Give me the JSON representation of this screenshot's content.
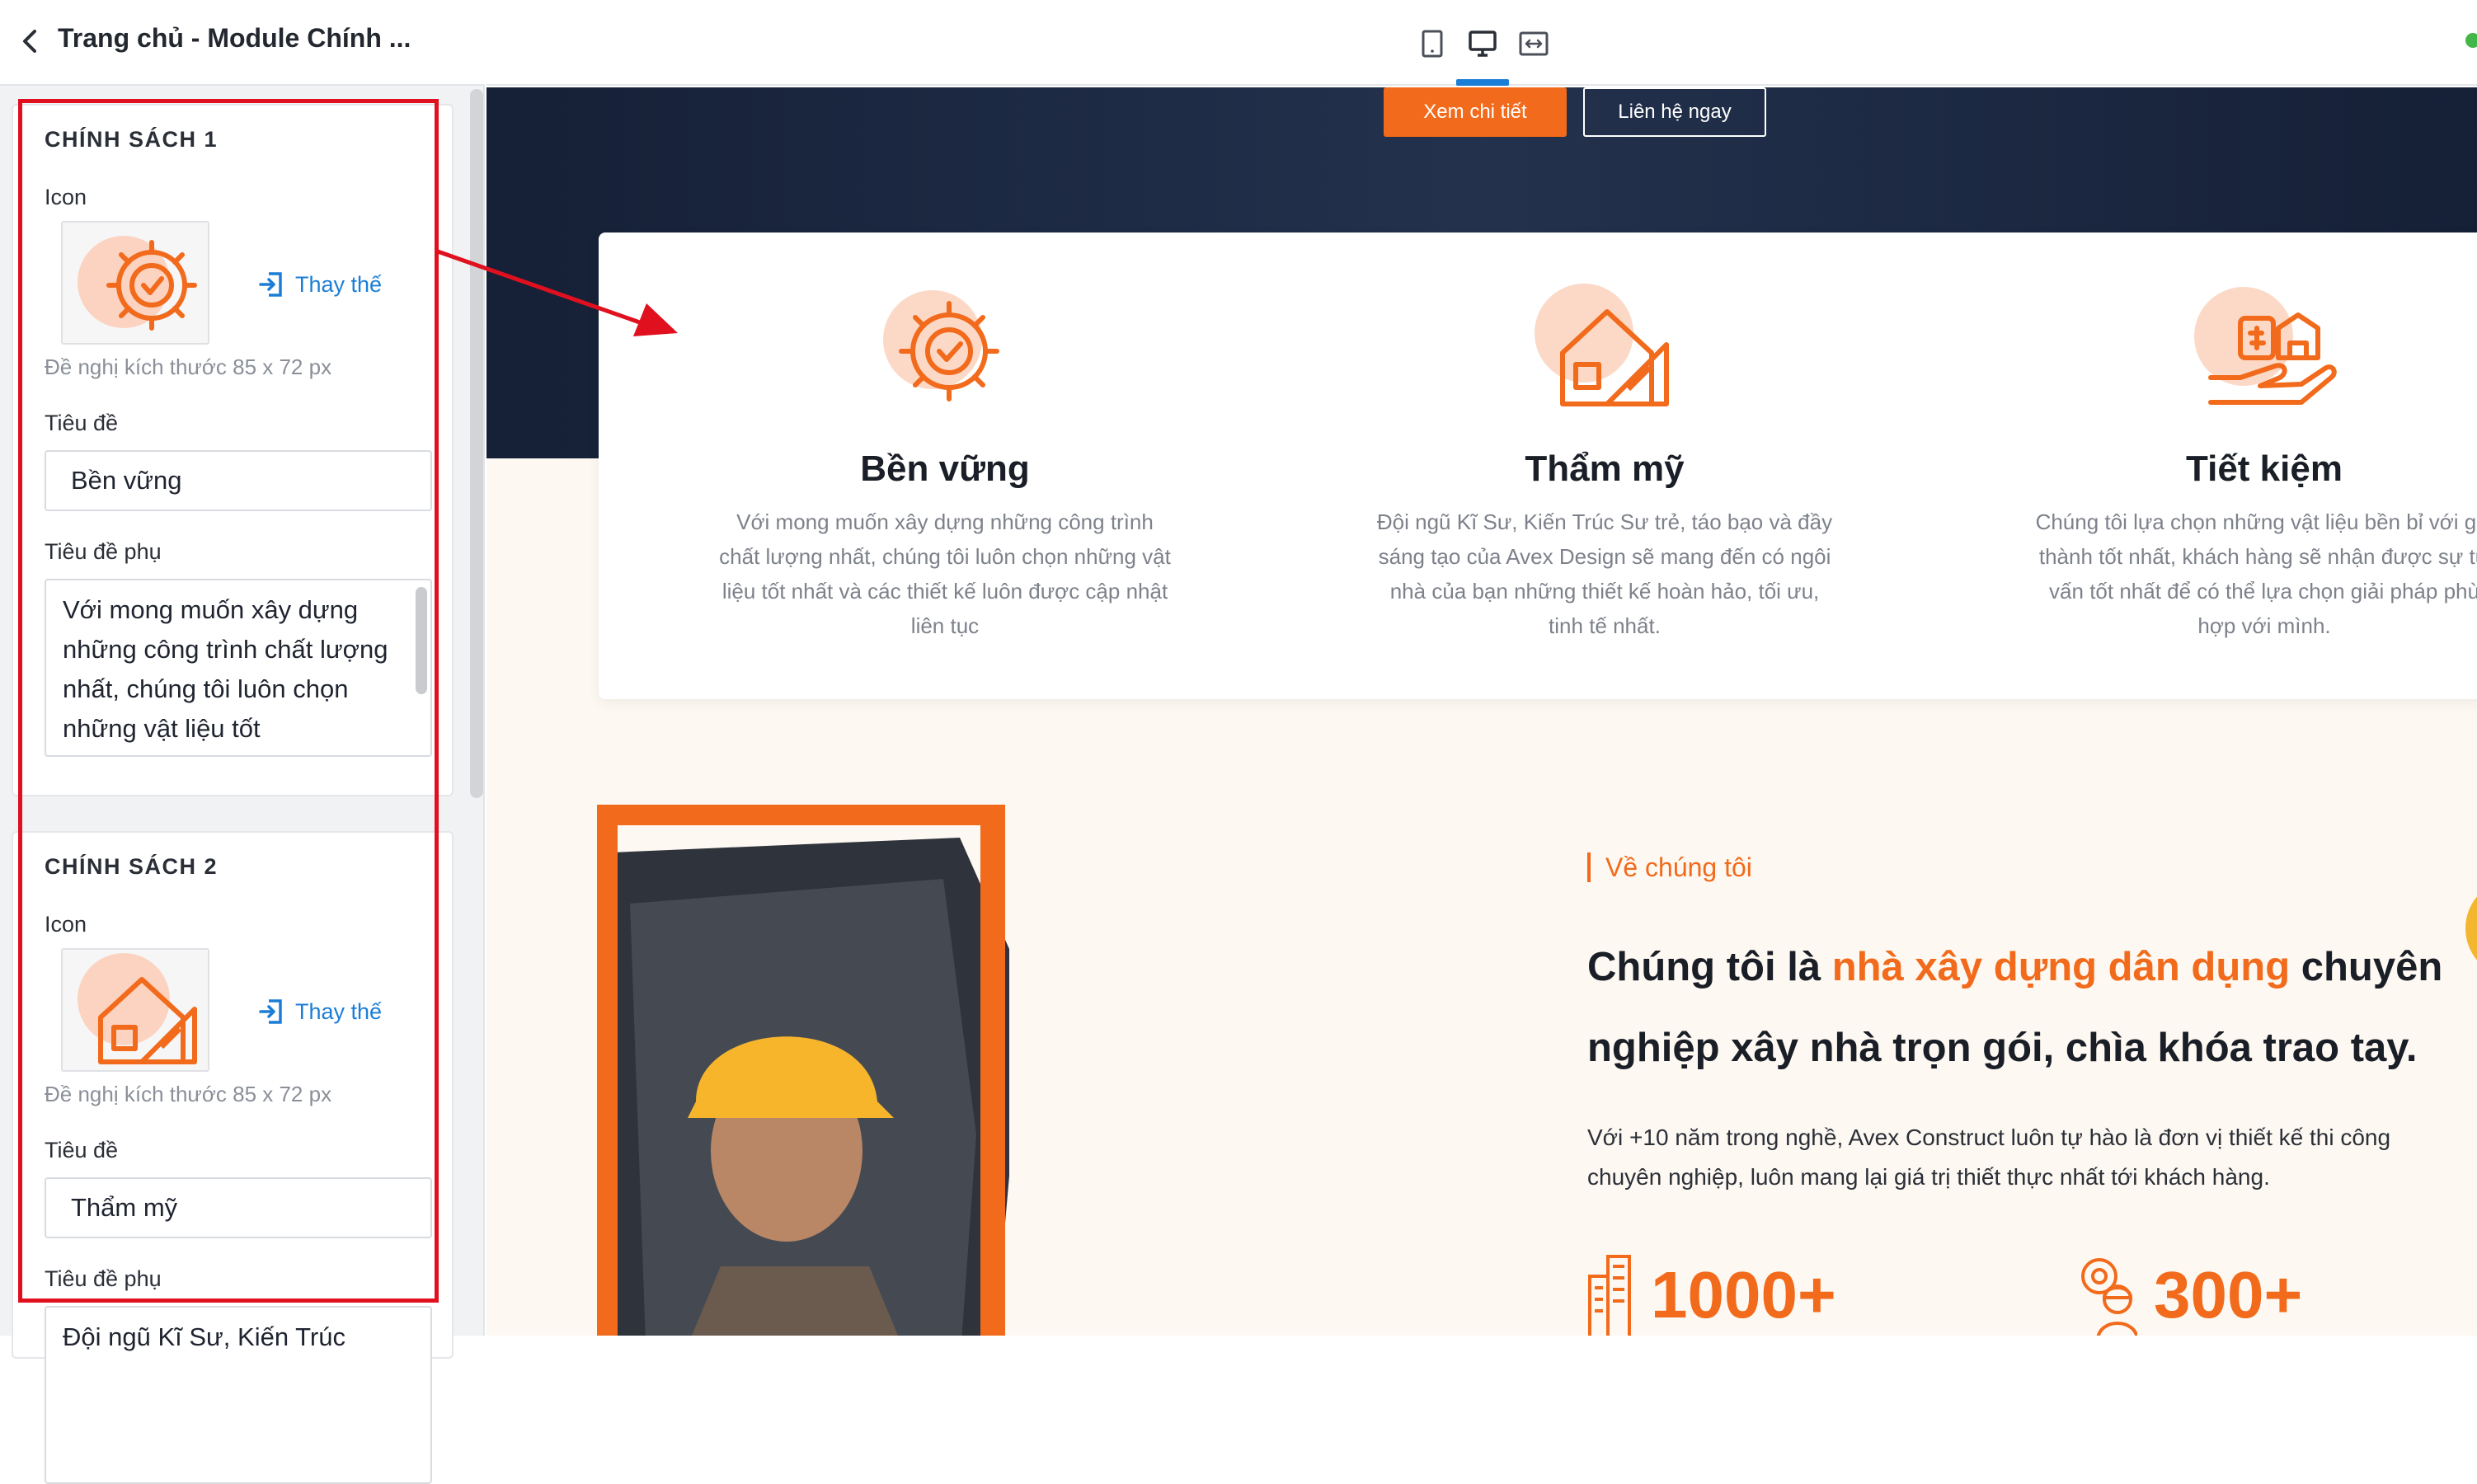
{
  "editor": {
    "title": "Trang chủ - Module Chính ...",
    "sections": [
      {
        "heading": "CHÍNH SÁCH 1",
        "icon_label": "Icon",
        "icon": "gear-check-icon",
        "replace_label": "Thay thế",
        "size_hint": "Đề nghị kích thước 85 x 72 px",
        "title_label": "Tiêu đề",
        "title_value": "Bền vững",
        "subtitle_label": "Tiêu đề phụ",
        "subtitle_value": "Với mong muốn xây dựng những công trình chất lượng nhất, chúng tôi luôn chọn những vật liệu tốt"
      },
      {
        "heading": "CHÍNH SÁCH 2",
        "icon_label": "Icon",
        "icon": "house-ruler-icon",
        "replace_label": "Thay thế",
        "size_hint": "Đề nghị kích thước 85 x 72 px",
        "title_label": "Tiêu đề",
        "title_value": "Thẩm mỹ",
        "subtitle_label": "Tiêu đề phụ",
        "subtitle_value": "Đội ngũ Kĩ Sư, Kiến Trúc"
      }
    ]
  },
  "toolbar": {
    "devices": [
      "tablet-icon",
      "desktop-icon",
      "fullwidth-icon"
    ],
    "active_device": "desktop-icon"
  },
  "preview": {
    "hero_buttons": {
      "primary": "Xem chi tiết",
      "secondary": "Liên hệ ngay"
    },
    "features": [
      {
        "icon": "gear-check-icon",
        "title": "Bền vững",
        "desc": "Với mong muốn xây dựng những công trình chất lượng nhất, chúng tôi luôn chọn những vật liệu tốt nhất và các thiết kế luôn được cập nhật liên tục"
      },
      {
        "icon": "house-ruler-icon",
        "title": "Thẩm mỹ",
        "desc": "Đội ngũ Kĩ Sư, Kiến Trúc Sư trẻ, táo bạo và đầy sáng tạo của Avex Design sẽ mang đến có ngôi nhà của bạn những thiết kế hoàn hảo, tối ưu, tinh tế nhất."
      },
      {
        "icon": "money-hand-icon",
        "title": "Tiết kiệm",
        "desc": "Chúng tôi lựa chọn những vật liệu bền bỉ với giá thành tốt nhất, khách hàng sẽ nhận được sự tư vấn tốt nhất để có thể lựa chọn giải pháp phù hợp với mình."
      }
    ],
    "about": {
      "tag": "Về chúng tôi",
      "heading_pre": "Chúng tôi là ",
      "heading_highlight": "nhà xây dựng dân dụng",
      "heading_post": " chuyên nghiệp xây nhà trọn gói, chìa khóa trao tay.",
      "paragraph": "Với +10 năm trong nghề, Avex Construct luôn tự hào là đơn vị thiết kế thi công chuyên nghiệp, luôn mang lại giá trị thiết thực nhất tới khách hàng.",
      "stats": [
        {
          "icon": "buildings-icon",
          "value": "1000+"
        },
        {
          "icon": "engineer-gear-icon",
          "value": "300+"
        }
      ]
    }
  },
  "colors": {
    "accent": "#f26a1b",
    "link": "#1b7ed6",
    "highlight_box": "#e0101f",
    "hero_bg": "#1d2b46",
    "page_bg": "#fdf8f1"
  }
}
